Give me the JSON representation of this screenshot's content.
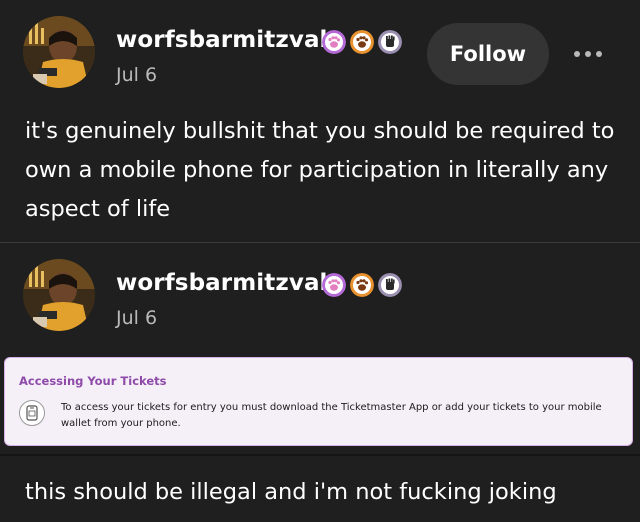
{
  "post1": {
    "username": "worfsbarmitzvah",
    "date": "Jul 6",
    "follow_label": "Follow",
    "body": "it's genuinely bullshit that you should be required to own a mobile phone for participation in literally any aspect of life"
  },
  "post2": {
    "username": "worfsbarmitzvah",
    "date": "Jul 6",
    "embed": {
      "title": "Accessing Your Tickets",
      "text": "To access your tickets for entry you must download the Ticketmaster App or add your tickets to your mobile wallet from your phone."
    },
    "body": "this should be illegal and i'm not fucking joking"
  },
  "badges": [
    {
      "name": "purple-paw-badge-icon",
      "color": "#b46ad6"
    },
    {
      "name": "orange-paw-badge-icon",
      "color": "#e8912f"
    },
    {
      "name": "gray-hand-badge-icon",
      "color": "#9a8fb0"
    }
  ],
  "colors": {
    "background": "#1f1f1f",
    "follow_button": "#343434",
    "secondary_text": "#b9b9b9",
    "embed_background": "#f5eff8",
    "embed_border": "#d6b0e6",
    "embed_title": "#8e4aa8"
  },
  "icons": {
    "more": "more-horizontal-icon",
    "phone": "mobile-phone-icon"
  }
}
